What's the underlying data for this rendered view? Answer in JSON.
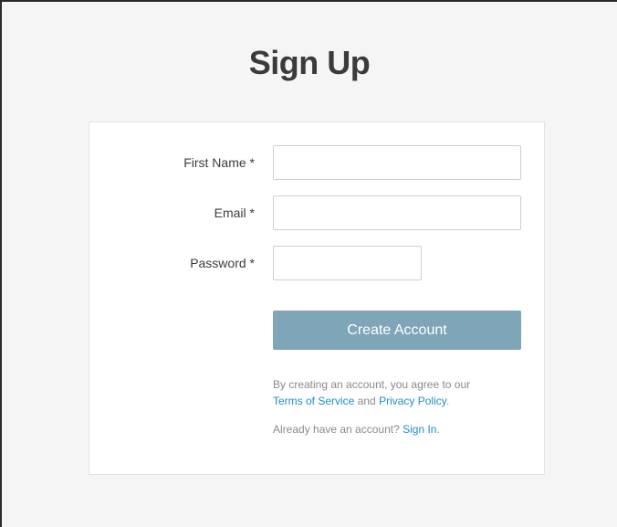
{
  "page": {
    "title": "Sign Up"
  },
  "form": {
    "fields": [
      {
        "label": "First Name *",
        "value": "",
        "placeholder": ""
      },
      {
        "label": "Email *",
        "value": "",
        "placeholder": ""
      },
      {
        "label": "Password *",
        "value": "",
        "placeholder": ""
      }
    ],
    "submit_label": "Create Account"
  },
  "legal": {
    "prefix": "By creating an account, you agree to our",
    "terms_link": "Terms of Service",
    "conjunction": "and",
    "privacy_link": "Privacy Policy",
    "suffix": "."
  },
  "signin": {
    "prompt": "Already have an account?",
    "link": "Sign In",
    "suffix": "."
  },
  "colors": {
    "button_bg": "#7ea5b8",
    "link": "#1a8fc9",
    "background": "#f5f5f5"
  }
}
